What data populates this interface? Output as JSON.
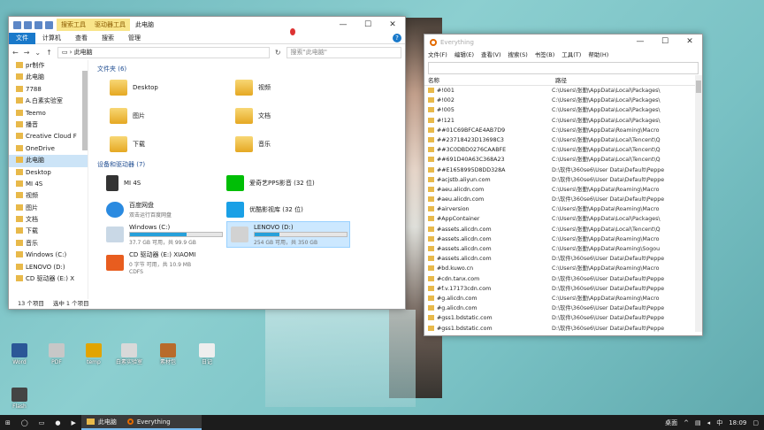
{
  "explorer": {
    "title": "此电脑",
    "ctx_tabs": [
      "搜索工具",
      "驱动器工具"
    ],
    "ribbon": [
      "文件",
      "计算机",
      "查看",
      "搜索",
      "管理"
    ],
    "help": "?",
    "address": "此电脑",
    "search_placeholder": "搜索\"此电脑\"",
    "sidebar": [
      {
        "label": "pr制作"
      },
      {
        "label": "此电脑"
      },
      {
        "label": "7788"
      },
      {
        "label": "A.白素实验室"
      },
      {
        "label": "Teemo"
      },
      {
        "label": "播音"
      },
      {
        "label": "Creative Cloud F"
      },
      {
        "label": "OneDrive"
      },
      {
        "label": "此电脑",
        "selected": true
      },
      {
        "label": "Desktop"
      },
      {
        "label": "MI 4S"
      },
      {
        "label": "视频"
      },
      {
        "label": "图片"
      },
      {
        "label": "文档"
      },
      {
        "label": "下载"
      },
      {
        "label": "音乐"
      },
      {
        "label": "Windows (C:)"
      },
      {
        "label": "LENOVO (D:)"
      },
      {
        "label": "CD 驱动器 (E:) X"
      }
    ],
    "folders_header": "文件夹 (6)",
    "folders": [
      "Desktop",
      "视频",
      "图片",
      "文档",
      "下载",
      "音乐"
    ],
    "devices_header": "设备和驱动器 (7)",
    "devices": [
      {
        "name": "MI 4S",
        "sub": ""
      },
      {
        "name": "爱奇艺PPS影音 (32 位)",
        "sub": ""
      },
      {
        "name": "百度网盘",
        "sub": "双击运行百度网盘"
      },
      {
        "name": "优酷影视库 (32 位)",
        "sub": ""
      }
    ],
    "drives": [
      {
        "name": "Windows (C:)",
        "sub": "37.7 GB 可用，共 99.9 GB",
        "fill": 0.62
      },
      {
        "name": "LENOVO (D:)",
        "sub": "254 GB 可用，共 350 GB",
        "fill": 0.27,
        "selected": true
      }
    ],
    "cd": {
      "name": "CD 驱动器 (E:) XIAOMI",
      "sub1": "0 字节 可用，共 10.9 MB",
      "sub2": "CDFS"
    },
    "status": [
      "13 个项目",
      "选中 1 个项目"
    ]
  },
  "everything": {
    "title": "Everything",
    "menu": [
      "文件(F)",
      "编辑(E)",
      "查看(V)",
      "搜索(S)",
      "书签(B)",
      "工具(T)",
      "帮助(H)"
    ],
    "col_name": "名称",
    "col_path": "路径",
    "rows": [
      {
        "name": "#!001",
        "path": "C:\\Users\\张勤\\AppData\\Local\\Packages\\"
      },
      {
        "name": "#!002",
        "path": "C:\\Users\\张勤\\AppData\\Local\\Packages\\"
      },
      {
        "name": "#!005",
        "path": "C:\\Users\\张勤\\AppData\\Local\\Packages\\"
      },
      {
        "name": "#!121",
        "path": "C:\\Users\\张勤\\AppData\\Local\\Packages\\"
      },
      {
        "name": "##01C69BFCAE4AB7D9",
        "path": "C:\\Users\\张勤\\AppData\\Roaming\\Macro"
      },
      {
        "name": "##23718423D13698C3",
        "path": "C:\\Users\\张勤\\AppData\\Local\\Tencent\\Q"
      },
      {
        "name": "##3C0DBD0276CAABFE",
        "path": "C:\\Users\\张勤\\AppData\\Local\\Tencent\\Q"
      },
      {
        "name": "##691D40A63C368A23",
        "path": "C:\\Users\\张勤\\AppData\\Local\\Tencent\\Q"
      },
      {
        "name": "##E1658995D8DD328A",
        "path": "D:\\软件\\360se6\\User Data\\Default\\Peppe"
      },
      {
        "name": "#acjstb.aliyun.com",
        "path": "D:\\软件\\360se6\\User Data\\Default\\Peppe"
      },
      {
        "name": "#aeu.alicdn.com",
        "path": "C:\\Users\\张勤\\AppData\\Roaming\\Macro"
      },
      {
        "name": "#aeu.alicdn.com",
        "path": "D:\\软件\\360se6\\User Data\\Default\\Peppe"
      },
      {
        "name": "#airversion",
        "path": "C:\\Users\\张勤\\AppData\\Roaming\\Macro"
      },
      {
        "name": "#AppContainer",
        "path": "C:\\Users\\张勤\\AppData\\Local\\Packages\\"
      },
      {
        "name": "#assets.alicdn.com",
        "path": "C:\\Users\\张勤\\AppData\\Local\\Tencent\\Q"
      },
      {
        "name": "#assets.alicdn.com",
        "path": "C:\\Users\\张勤\\AppData\\Roaming\\Macro"
      },
      {
        "name": "#assets.alicdn.com",
        "path": "C:\\Users\\张勤\\AppData\\Roaming\\Sogou"
      },
      {
        "name": "#assets.alicdn.com",
        "path": "D:\\软件\\360se6\\User Data\\Default\\Peppe"
      },
      {
        "name": "#bd.kuwo.cn",
        "path": "C:\\Users\\张勤\\AppData\\Roaming\\Macro"
      },
      {
        "name": "#cdn.tanx.com",
        "path": "D:\\软件\\360se6\\User Data\\Default\\Peppe"
      },
      {
        "name": "#f.v.17173cdn.com",
        "path": "D:\\软件\\360se6\\User Data\\Default\\Peppe"
      },
      {
        "name": "#g.alicdn.com",
        "path": "C:\\Users\\张勤\\AppData\\Roaming\\Macro"
      },
      {
        "name": "#g.alicdn.com",
        "path": "D:\\软件\\360se6\\User Data\\Default\\Peppe"
      },
      {
        "name": "#gss1.bdstatic.com",
        "path": "D:\\软件\\360se6\\User Data\\Default\\Peppe"
      },
      {
        "name": "#gss1.bdstatic.com",
        "path": "D:\\软件\\360se6\\User Data\\Default\\Peppe"
      }
    ]
  },
  "desktop_icons": [
    "Word",
    "PDF",
    "Rename",
    "temp",
    "白素实验室",
    "素材包",
    "Flash",
    "日记"
  ],
  "taskbar": {
    "items": [
      "此电脑",
      "Everything"
    ],
    "tray_label": "桌面",
    "ime": "中",
    "time": "18:09"
  }
}
